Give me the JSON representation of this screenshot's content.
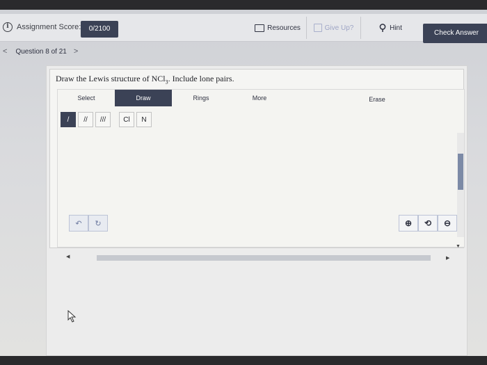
{
  "topbar": {
    "score_label": "Assignment Score:",
    "score_value": "0/2100",
    "resources": "Resources",
    "give_up": "Give Up?",
    "hint": "Hint",
    "check_answer": "Check Answer"
  },
  "nav": {
    "question": "Question 8 of 21"
  },
  "question": {
    "prompt_pre": "Draw the Lewis structure of NCl",
    "prompt_sub": "3",
    "prompt_post": ". Include lone pairs."
  },
  "editor": {
    "tabs": [
      "Select",
      "Draw",
      "Rings",
      "More",
      "Erase"
    ],
    "active_tab": "Draw",
    "bond_tools": [
      "/",
      "//",
      "///"
    ],
    "atom_tools": [
      "Cl",
      "N"
    ]
  },
  "icons": {
    "info": "info-icon",
    "resources": "folder-icon",
    "give_up": "give-up-icon",
    "hint": "lightbulb-icon",
    "undo": "undo-icon",
    "redo": "redo-icon",
    "zoom_in": "zoom-in-icon",
    "zoom_reset": "zoom-reset-icon",
    "zoom_out": "zoom-out-icon"
  },
  "colors": {
    "primary": "#3b4256",
    "accent_scroll": "#7c8aa6"
  }
}
